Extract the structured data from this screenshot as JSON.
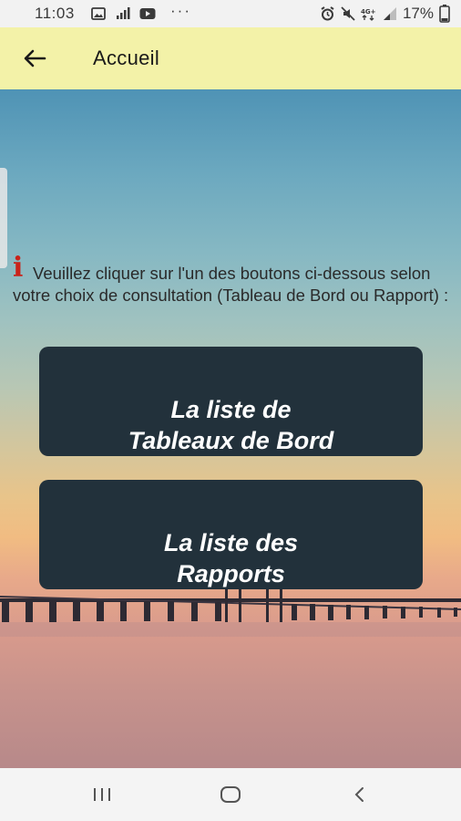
{
  "status_bar": {
    "time": "11:03",
    "battery": "17%",
    "left_icons": [
      "image-icon",
      "signal-bars-icon",
      "youtube-icon",
      "more-dots-icon"
    ],
    "right_icons": [
      "alarm-icon",
      "mute-icon",
      "4g-icon",
      "signal-icon",
      "battery-icon"
    ]
  },
  "app_bar": {
    "title": "Accueil",
    "background": "#f3f2a8"
  },
  "main": {
    "info_icon": "i",
    "info_text": "Veuillez cliquer sur l'un des boutons ci-dessous selon votre choix de consultation (Tableau de Bord ou Rapport) :",
    "buttons": [
      {
        "line1": "La liste de",
        "line2": "Tableaux de Bord"
      },
      {
        "line1": "La liste des",
        "line2": "Rapports"
      }
    ],
    "button_color": "#22313b",
    "info_icon_color": "#c9231a"
  },
  "nav_bar": {
    "icons": [
      "recent-apps-icon",
      "home-icon",
      "back-icon"
    ]
  }
}
